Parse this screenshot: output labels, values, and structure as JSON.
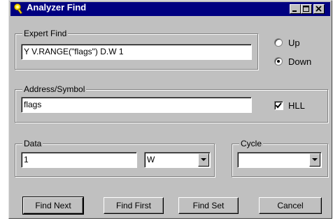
{
  "window": {
    "title": "Analyzer Find",
    "icon": "magnifier-key-icon",
    "controls": [
      "minimize-icon",
      "maximize-icon",
      "close-icon"
    ]
  },
  "expert_find": {
    "legend": "Expert Find",
    "value": "Y V.RANGE(\"flags\") D.W 1"
  },
  "direction": {
    "up_label": "Up",
    "down_label": "Down",
    "selected": "Down"
  },
  "address": {
    "legend": "Address/Symbol",
    "value": "flags",
    "hll_label": "HLL",
    "hll_checked": true
  },
  "data": {
    "legend": "Data",
    "value": "1",
    "width_value": "W"
  },
  "cycle": {
    "legend": "Cycle",
    "value": ""
  },
  "buttons": {
    "find_next": "Find Next",
    "find_first": "Find First",
    "find_set": "Find Set",
    "cancel": "Cancel"
  },
  "colors": {
    "titlebar": "#000080",
    "face": "#c0c0c0"
  }
}
